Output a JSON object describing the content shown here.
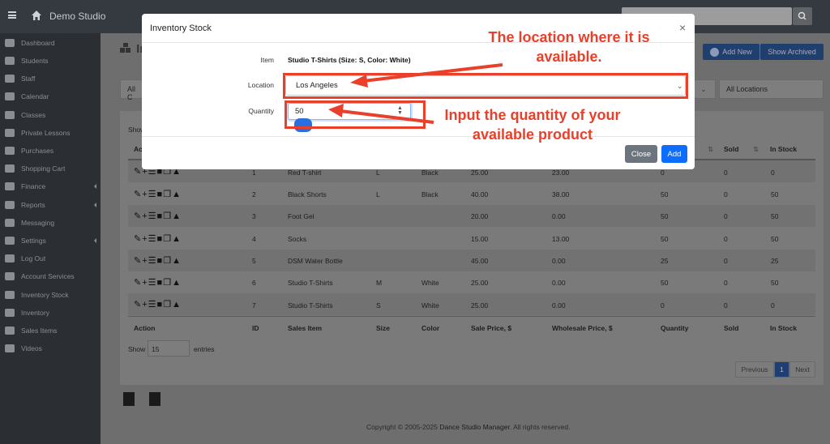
{
  "app": {
    "brand": "Demo Studio"
  },
  "sidebar": {
    "items": [
      {
        "label": "Dashboard",
        "icon": "dashboard-icon"
      },
      {
        "label": "Students",
        "icon": "students-icon"
      },
      {
        "label": "Staff",
        "icon": "staff-icon"
      },
      {
        "label": "Calendar",
        "icon": "calendar-icon"
      },
      {
        "label": "Classes",
        "icon": "classes-icon"
      },
      {
        "label": "Private Lessons",
        "icon": "private-lessons-icon"
      },
      {
        "label": "Purchases",
        "icon": "purchases-icon"
      },
      {
        "label": "Shopping Cart",
        "icon": "shopping-cart-icon"
      },
      {
        "label": "Finance",
        "icon": "finance-icon",
        "expandable": true
      },
      {
        "label": "Reports",
        "icon": "reports-icon",
        "expandable": true
      },
      {
        "label": "Messaging",
        "icon": "messaging-icon"
      },
      {
        "label": "Settings",
        "icon": "settings-icon",
        "expandable": true
      },
      {
        "label": "Log Out",
        "icon": "logout-icon"
      },
      {
        "label": "Account Services",
        "icon": "account-services-icon"
      },
      {
        "label": "Inventory Stock",
        "icon": "inventory-stock-icon"
      },
      {
        "label": "Inventory",
        "icon": "inventory-icon"
      },
      {
        "label": "Sales Items",
        "icon": "sales-items-icon"
      },
      {
        "label": "Videos",
        "icon": "videos-icon"
      }
    ]
  },
  "page": {
    "title_fragment": "In",
    "add_new": "Add New",
    "show_archived": "Show Archived",
    "filter_left": "All C",
    "filter_location": "All Locations",
    "show_label_top": "Show"
  },
  "table": {
    "columns": [
      "Action",
      "ID",
      "Sales Item",
      "Size",
      "Color",
      "Sale Price, $",
      "Wholesale Price, $",
      "Quantity",
      "Sold",
      "In Stock"
    ],
    "visible_header": {
      "quantity_sort": "⇅",
      "sold": "Sold",
      "sold_sort": "⇅",
      "in_stock": "In Stock",
      "action_fragment": "Acti"
    },
    "rows": [
      {
        "id": "1",
        "item": "Red T-shirt",
        "size": "L",
        "color": "Black",
        "sale": "25.00",
        "wholesale": "23.00",
        "qty": "0",
        "sold": "0",
        "stock": "0"
      },
      {
        "id": "2",
        "item": "Black Shorts",
        "size": "L",
        "color": "Black",
        "sale": "40.00",
        "wholesale": "38.00",
        "qty": "50",
        "sold": "0",
        "stock": "50"
      },
      {
        "id": "3",
        "item": "Foot Gel",
        "size": "",
        "color": "",
        "sale": "20.00",
        "wholesale": "0.00",
        "qty": "50",
        "sold": "0",
        "stock": "50"
      },
      {
        "id": "4",
        "item": "Socks",
        "size": "",
        "color": "",
        "sale": "15.00",
        "wholesale": "13.00",
        "qty": "50",
        "sold": "0",
        "stock": "50"
      },
      {
        "id": "5",
        "item": "DSM Water Bottle",
        "size": "",
        "color": "",
        "sale": "45.00",
        "wholesale": "0.00",
        "qty": "25",
        "sold": "0",
        "stock": "25"
      },
      {
        "id": "6",
        "item": "Studio T-Shirts",
        "size": "M",
        "color": "White",
        "sale": "25.00",
        "wholesale": "0.00",
        "qty": "50",
        "sold": "0",
        "stock": "50"
      },
      {
        "id": "7",
        "item": "Studio T-Shirts",
        "size": "S",
        "color": "White",
        "sale": "25.00",
        "wholesale": "0.00",
        "qty": "0",
        "sold": "0",
        "stock": "0"
      }
    ],
    "show_label": "Show",
    "show_value": "15",
    "entries_label": "entries"
  },
  "pagination": {
    "previous": "Previous",
    "current": "1",
    "next": "Next"
  },
  "footer": {
    "prefix": "Copyright © 2005-2025 ",
    "link": "Dance Studio Manager",
    "suffix": ". All rights reserved."
  },
  "modal": {
    "title": "Inventory Stock",
    "close_glyph": "×",
    "item_label": "Item",
    "item_value": "Studio T-Shirts (Size: S, Color: White)",
    "location_label": "Location",
    "location_value": "Los Angeles",
    "quantity_label": "Quantity",
    "quantity_value": "50",
    "close_button": "Close",
    "add_button": "Add"
  },
  "annotations": {
    "location_note": "The location where it is available.",
    "quantity_note": "Input the quantity of your available product"
  },
  "colors": {
    "accent": "#0d6efd",
    "annotation": "#e8402a",
    "sidebar_bg": "#2b2f33",
    "topbar_bg": "#343a40"
  }
}
